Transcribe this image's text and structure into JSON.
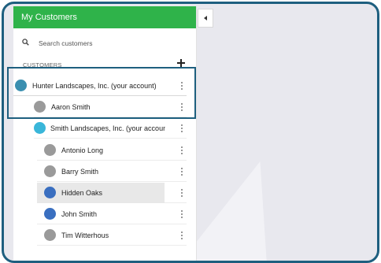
{
  "panel": {
    "title": "My Customers",
    "header_color": "#2fb34a"
  },
  "search": {
    "placeholder": "Search customers"
  },
  "section": {
    "label": "CUSTOMERS"
  },
  "customers": [
    {
      "name": "Hunter Landscapes, Inc. (your account)",
      "avatar_color": "#3a8fb0",
      "level": 0
    },
    {
      "name": "Aaron Smith",
      "avatar_color": "#9a9a9a",
      "level": 1
    },
    {
      "name": "Smith Landscapes, Inc. (your account)",
      "avatar_color": "#3ab6d9",
      "level": 1
    },
    {
      "name": "Antonio Long",
      "avatar_color": "#9a9a9a",
      "level": 2
    },
    {
      "name": "Barry Smith",
      "avatar_color": "#9a9a9a",
      "level": 2
    },
    {
      "name": "Hidden Oaks",
      "avatar_color": "#3a6fc0",
      "level": 2,
      "selected": true
    },
    {
      "name": "John Smith",
      "avatar_color": "#3a6fc0",
      "level": 2
    },
    {
      "name": "Tim Witterhous",
      "avatar_color": "#9a9a9a",
      "level": 2
    }
  ],
  "colors": {
    "frame": "#1e5f7f",
    "highlight": "#1e5f7f"
  }
}
